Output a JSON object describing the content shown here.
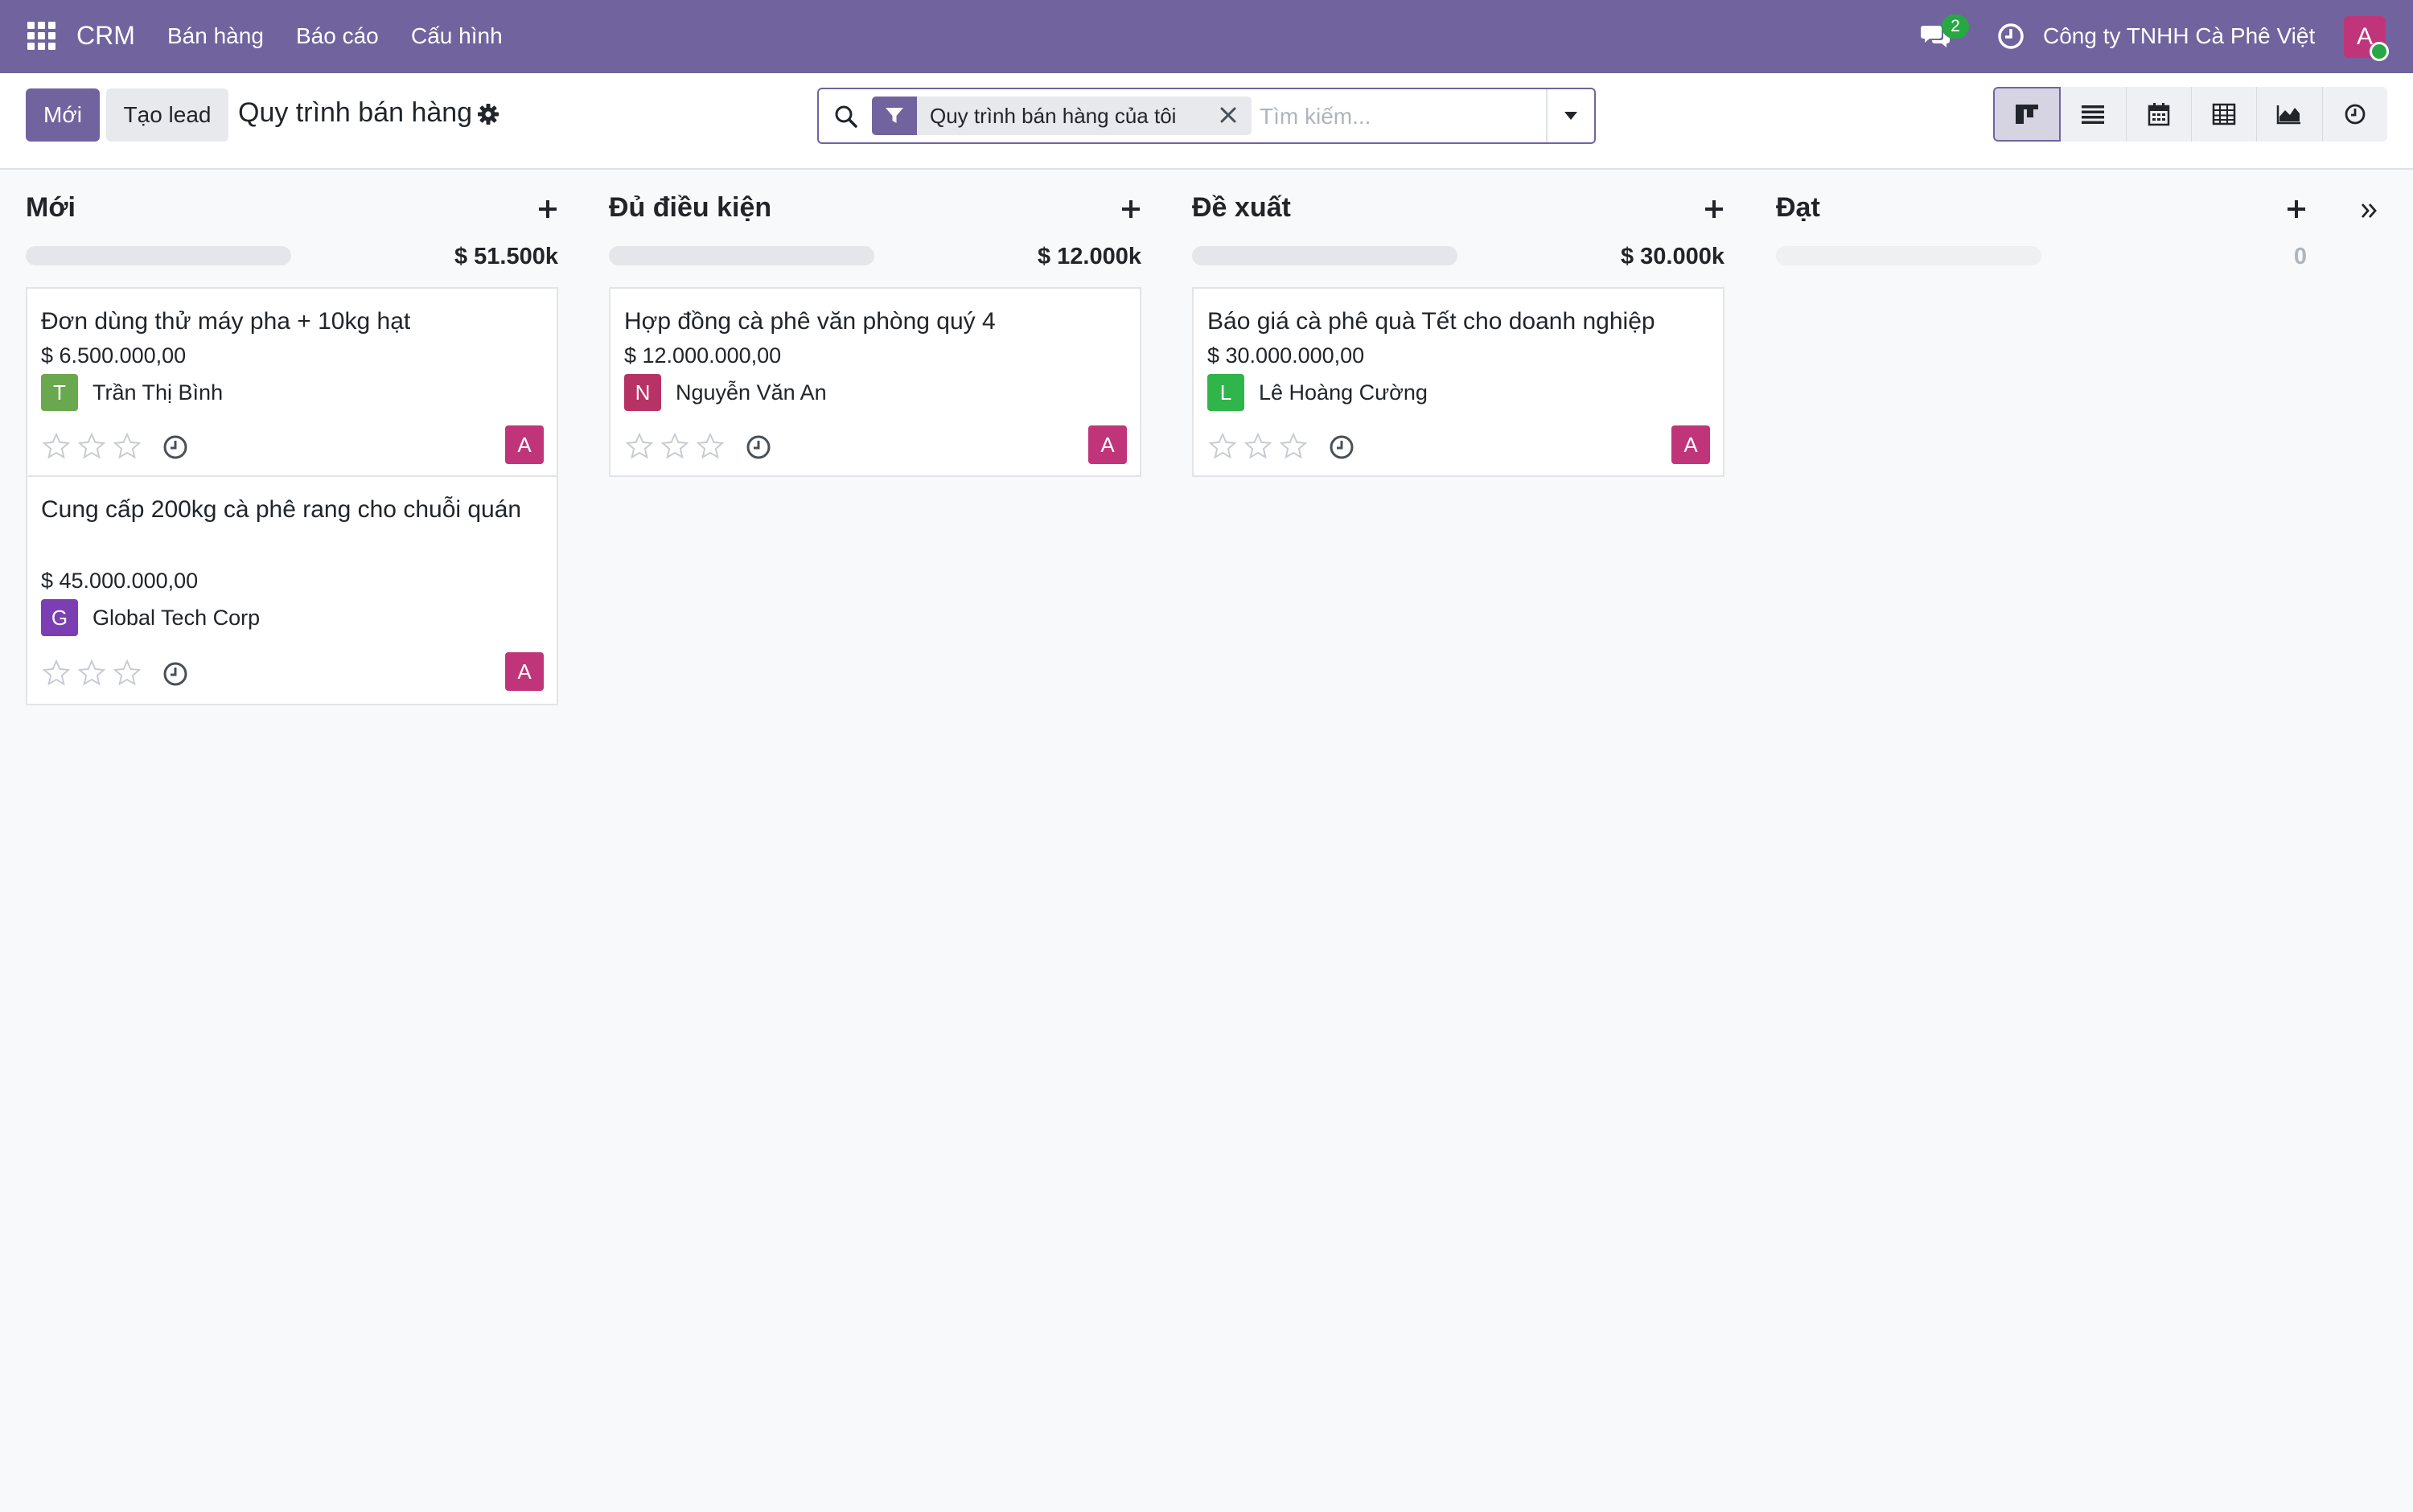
{
  "navbar": {
    "brand": "CRM",
    "menu": [
      "Bán hàng",
      "Báo cáo",
      "Cấu hình"
    ],
    "message_count": "2",
    "company": "Công ty TNHH Cà Phê Việt",
    "user_initial": "A"
  },
  "control": {
    "new_label": "Mới",
    "lead_label": "Tạo lead",
    "breadcrumb": "Quy trình bán hàng",
    "search": {
      "facet": "Quy trình bán hàng của tôi",
      "placeholder": "Tìm kiếm..."
    },
    "views": [
      "kanban-icon",
      "list-icon",
      "calendar-icon",
      "pivot-icon",
      "graph-icon",
      "activity-icon"
    ],
    "active_view": "kanban"
  },
  "columns": [
    {
      "title": "Mới",
      "total": "$ 51.500k",
      "cards": [
        {
          "title": "Đơn dùng thử máy pha + 10kg hạt",
          "amount": "$ 6.500.000,00",
          "contact_initial": "T",
          "contact_color": "#6aa84f",
          "contact": "Trần Thị Bình",
          "user_initial": "A"
        },
        {
          "title": "Cung cấp 200kg cà phê rang cho chuỗi quán",
          "amount": "$ 45.000.000,00",
          "contact_initial": "G",
          "contact_color": "#7b3fb3",
          "contact": "Global Tech Corp",
          "user_initial": "A"
        }
      ]
    },
    {
      "title": "Đủ điều kiện",
      "total": "$ 12.000k",
      "cards": [
        {
          "title": "Hợp đồng cà phê văn phòng quý 4",
          "amount": "$ 12.000.000,00",
          "contact_initial": "N",
          "contact_color": "#b83365",
          "contact": "Nguyễn Văn An",
          "user_initial": "A"
        }
      ]
    },
    {
      "title": "Đề xuất",
      "total": "$ 30.000k",
      "cards": [
        {
          "title": "Báo giá cà phê quà Tết cho doanh nghiệp",
          "amount": "$ 30.000.000,00",
          "contact_initial": "L",
          "contact_color": "#2fb54a",
          "contact": "Lê Hoàng Cường",
          "user_initial": "A"
        }
      ]
    },
    {
      "title": "Đạt",
      "total": "0",
      "cards": []
    }
  ],
  "colors": {
    "brand": "#71639e",
    "user_avatar": "#c0357a",
    "badge": "#28a745"
  }
}
